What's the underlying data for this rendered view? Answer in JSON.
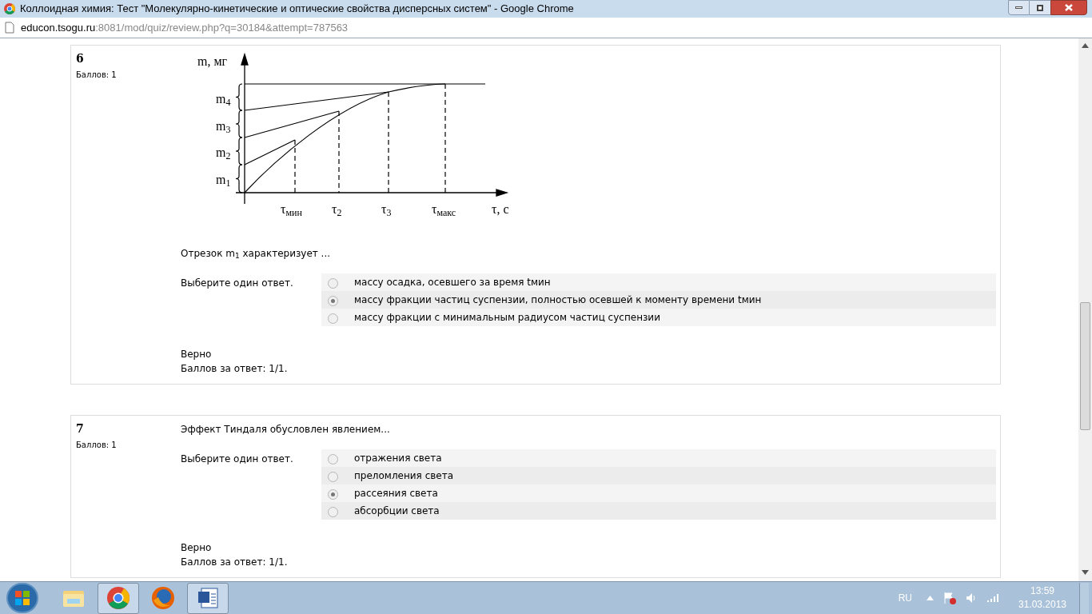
{
  "window": {
    "title": "Коллоидная химия: Тест \"Молекулярно-кинетические и оптические свойства дисперсных систем\" - Google Chrome"
  },
  "address_bar": {
    "host": "educon.tsogu.ru",
    "path": ":8081/mod/quiz/review.php?q=30184&attempt=787563"
  },
  "questions": [
    {
      "number": "6",
      "points": "Баллов: 1",
      "figure": {
        "y_axis_label": "m, мг",
        "y_labels": [
          "m$_{4}$",
          "m$_{3}$",
          "m$_{2}$",
          "m$_{1}$"
        ],
        "x_labels": [
          "τ$_{мин}$",
          "τ$_{2}$",
          "τ$_{3}$",
          "τ$_{макс}$"
        ],
        "x_axis_label": "τ, с"
      },
      "text": "Отрезок m$_{1}$ характеризует ...",
      "prompt": "Выберите один ответ.",
      "answers": [
        {
          "text": "массу осадка, осевшего за время tмин",
          "selected": false
        },
        {
          "text": "массу фракции частиц суспензии, полностью осевшей к моменту времени tмин",
          "selected": true
        },
        {
          "text": "массу фракции с минимальным радиусом частиц суспензии",
          "selected": false
        }
      ],
      "result": "Верно",
      "score": "Баллов за ответ: 1/1."
    },
    {
      "number": "7",
      "points": "Баллов: 1",
      "text": "Эффект Тиндаля обусловлен явлением...",
      "prompt": "Выберите один ответ.",
      "answers": [
        {
          "text": "отражения света",
          "selected": false
        },
        {
          "text": "преломления света",
          "selected": false
        },
        {
          "text": "рассеяния света",
          "selected": true
        },
        {
          "text": "абсорбции света",
          "selected": false
        }
      ],
      "result": "Верно",
      "score": "Баллов за ответ: 1/1."
    }
  ],
  "taskbar": {
    "apps": [
      {
        "kind": "explorer",
        "running": false
      },
      {
        "kind": "chrome",
        "running": true
      },
      {
        "kind": "firefox",
        "running": false
      },
      {
        "kind": "word",
        "running": true
      }
    ],
    "language": "RU",
    "time": "13:59",
    "date": "31.03.2013"
  }
}
